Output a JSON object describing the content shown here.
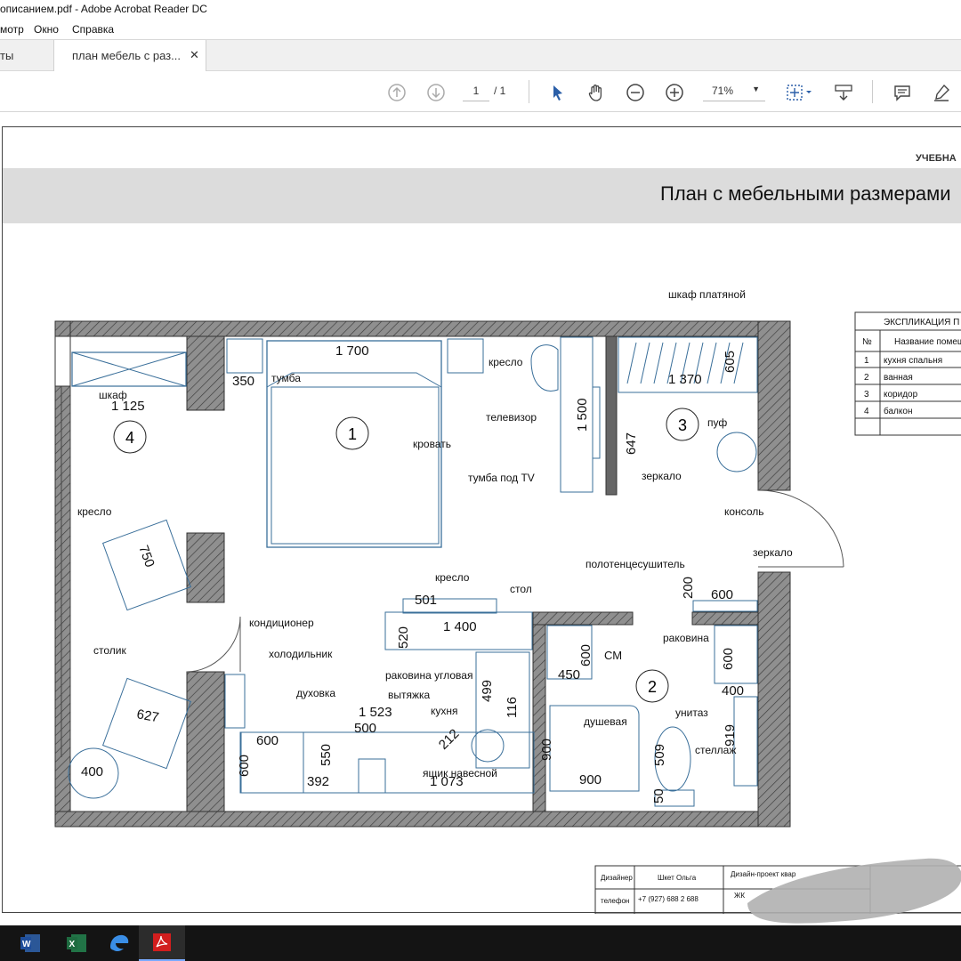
{
  "window": {
    "title": "описанием.pdf - Adobe Acrobat Reader DC"
  },
  "menu": [
    "мотр",
    "Окно",
    "Справка"
  ],
  "tabs": [
    {
      "label": "ты",
      "active": false
    },
    {
      "label": "план мебель с раз...",
      "active": true
    }
  ],
  "toolbar": {
    "page_current": "1",
    "page_total": "/ 1",
    "zoom": "71%",
    "icons": [
      "prev-page-icon",
      "next-page-icon",
      "select-cursor-icon",
      "hand-tool-icon",
      "zoom-out-icon",
      "zoom-in-icon",
      "fit-page-icon",
      "scroll-mode-icon",
      "comment-icon",
      "highlight-icon"
    ]
  },
  "document": {
    "header_right": "УЧЕБНА",
    "title": "План с мебельными размерами",
    "rooms": [
      "1",
      "2",
      "3",
      "4"
    ],
    "labels": {
      "wardrobe": "шкаф платяной",
      "armchair_bed": "кресло",
      "nightstand": "тумба",
      "tv": "телевизор",
      "tv_stand": "тумба под TV",
      "bed": "кровать",
      "mirror1": "зеркало",
      "pouf": "пуф",
      "closet": "шкаф",
      "armchair_balcony": "кресло",
      "table_small": "столик",
      "console": "консоль",
      "mirror2": "зеркало",
      "towel": "полотенцесушитель",
      "armchair_kitchen": "кресло",
      "table": "стол",
      "ac": "кондиционер",
      "fridge": "холодильник",
      "sink_corner": "раковина угловая",
      "oven": "духовка",
      "hood": "вытяжка",
      "kitchen": "кухня",
      "cabinet_wall": "ящик навесной",
      "washer": "СМ",
      "shower": "душевая",
      "toilet": "унитаз",
      "sink": "раковина",
      "rack": "стеллаж"
    },
    "dims": {
      "bed_w": "1 700",
      "nightstand_d": "350",
      "closet_w": "1 125",
      "wardrobe_w": "1 370",
      "wardrobe_d": "605",
      "tv_w": "1 500",
      "mirror_w": "647",
      "armchair1": "750",
      "armchair2": "627",
      "table_d": "400",
      "armchair_k": "501",
      "table_w": "1 400",
      "table_d2": "520",
      "kitchen_w": "1 523",
      "oven_w": "500",
      "fridge_w": "600",
      "fridge_d": "600",
      "oven_h": "550",
      "hood_w": "392",
      "cab_w": "1 073",
      "sink_w": "212",
      "sink_d": "499",
      "k_d": "116",
      "wm_w": "600",
      "wm_d": "450",
      "shower_w": "900",
      "shower_d": "900",
      "toilet": "509",
      "toilet2": "50",
      "console_w": "600",
      "console_d": "200",
      "sink2_w": "600",
      "sink2_d": "400",
      "rack_d": "919"
    },
    "explication": {
      "title": "ЭКСПЛИКАЦИЯ П",
      "col_no": "№",
      "col_name": "Название помещ",
      "rows": [
        {
          "no": "1",
          "name": "кухня спальня"
        },
        {
          "no": "2",
          "name": "ванная"
        },
        {
          "no": "3",
          "name": "коридор"
        },
        {
          "no": "4",
          "name": "балкон"
        }
      ]
    },
    "stamp": {
      "designer_label": "Дизайнер",
      "designer_name": "Шкет Ольга",
      "phone_label": "телефон",
      "phone": "+7 (927) 688 2 688",
      "project": "Дизайн-проект квар",
      "project2": "ЖК"
    }
  },
  "taskbar": [
    "word-icon",
    "excel-icon",
    "edge-icon",
    "acrobat-icon"
  ],
  "colors": {
    "wall_hatch": "#9a9a9a",
    "title_band": "#dcdcdc",
    "accent_blue": "#2b5fa8",
    "furniture_line": "#3a6f9a",
    "taskbar": "#141414"
  }
}
